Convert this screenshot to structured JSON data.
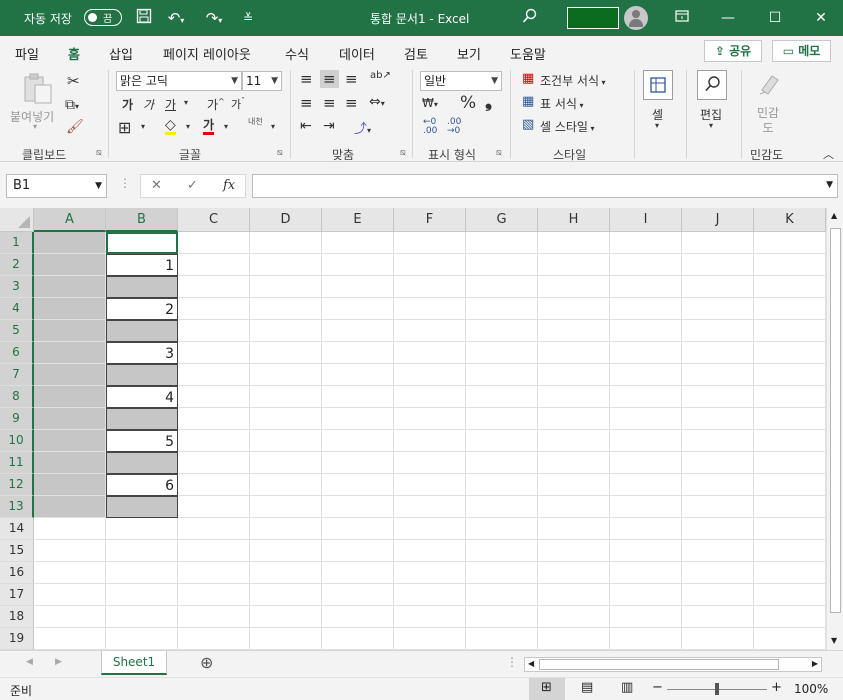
{
  "titlebar": {
    "autosave_label": "자동 저장",
    "autosave_state": "끔",
    "doc_title": "통합 문서1  -  Excel",
    "icons": [
      "save-icon",
      "undo-icon",
      "redo-icon",
      "customize-icon",
      "search-icon",
      "ribbon-display-icon",
      "minimize-icon",
      "maximize-icon",
      "close-icon"
    ]
  },
  "tabs": [
    "파일",
    "홈",
    "삽입",
    "페이지 레이아웃",
    "수식",
    "데이터",
    "검토",
    "보기",
    "도움말"
  ],
  "share_label": "공유",
  "memo_label": "메모",
  "ribbon": {
    "clipboard": {
      "paste": "붙여넣기",
      "label": "클립보드"
    },
    "font": {
      "name": "맑은 고딕",
      "size": "11",
      "label": "글꼴",
      "bold": "가",
      "italic": "가",
      "underline": "가",
      "grow": "가",
      "shrink": "가",
      "color": "가",
      "phonetic": "내천"
    },
    "align": {
      "label": "맞춤"
    },
    "number": {
      "format": "일반",
      "label": "표시 형식",
      "percent": "%",
      "comma": "❟"
    },
    "styles": {
      "conditional": "조건부 서식",
      "table": "표 서식",
      "cell": "셀 스타일",
      "label": "스타일"
    },
    "cells": {
      "label": "셀"
    },
    "editing": {
      "label": "편집"
    },
    "sensitivity": {
      "label": "민감도",
      "button": "민감\n도"
    }
  },
  "formula_bar": {
    "name_box": "B1",
    "fx": "fx",
    "value": ""
  },
  "columns": [
    "A",
    "B",
    "C",
    "D",
    "E",
    "F",
    "G",
    "H",
    "I",
    "J",
    "K"
  ],
  "rows": [
    "1",
    "2",
    "3",
    "4",
    "5",
    "6",
    "7",
    "8",
    "9",
    "10",
    "11",
    "12",
    "13",
    "14",
    "15",
    "16",
    "17",
    "18",
    "19"
  ],
  "cells_b": [
    "",
    "1",
    "",
    "2",
    "",
    "3",
    "",
    "4",
    "",
    "5",
    "",
    "6",
    ""
  ],
  "sheet_tab": "Sheet1",
  "status": {
    "ready": "준비",
    "zoom": "100%"
  }
}
